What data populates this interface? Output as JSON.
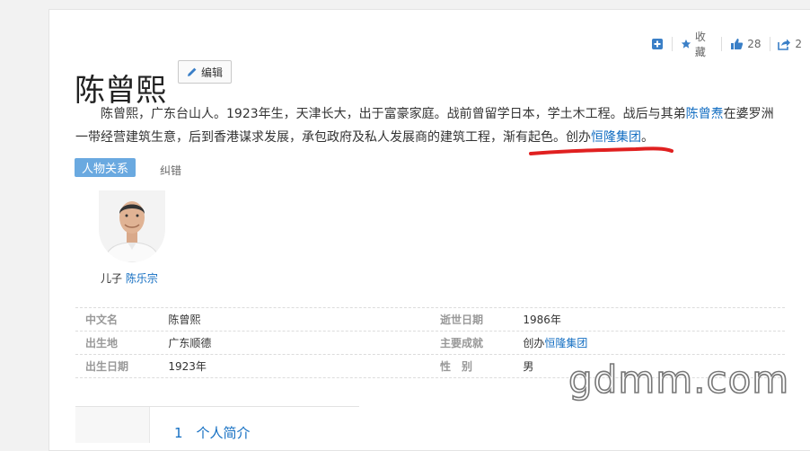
{
  "page": {
    "title": "陈曾熙",
    "edit_label": "编辑"
  },
  "toolbar": {
    "add_icon": "plus-square-icon",
    "favorite_label": "收藏",
    "like_count": "28",
    "share_count": "2"
  },
  "summary": {
    "part1": "陈曾熙，广东台山人。1923年生，天津长大，出于富豪家庭。战前曾留学日本，学土木工程。战后与其弟",
    "link1": "陈曾焘",
    "part2": "在婆罗洲一带经营建筑生意，后到香港谋求发展，承包政府及私人发展商的建筑工程，渐有起色。创办",
    "link2": "恒隆集团",
    "part3": "。"
  },
  "relations": {
    "tag_label": "人物关系",
    "report_label": "纠错",
    "person_relation": "儿子",
    "person_name": "陈乐宗"
  },
  "info": {
    "rows": [
      {
        "l1": "中文名",
        "v1": "陈曾熙",
        "l2": "逝世日期",
        "v2": "1986年"
      },
      {
        "l1": "出生地",
        "v1": "广东顺德",
        "l2": "主要成就",
        "v2_prefix": "创办",
        "v2_link": "恒隆集团"
      },
      {
        "l1": "出生日期",
        "v1": "1923年",
        "l2": "性　别",
        "v2": "男"
      }
    ]
  },
  "toc": {
    "first_item": "1　个人简介"
  },
  "watermark": "gdmm.com",
  "colors": {
    "link": "#136ec2",
    "tag_bg": "#6aa9e0",
    "annotation": "#e02020"
  }
}
